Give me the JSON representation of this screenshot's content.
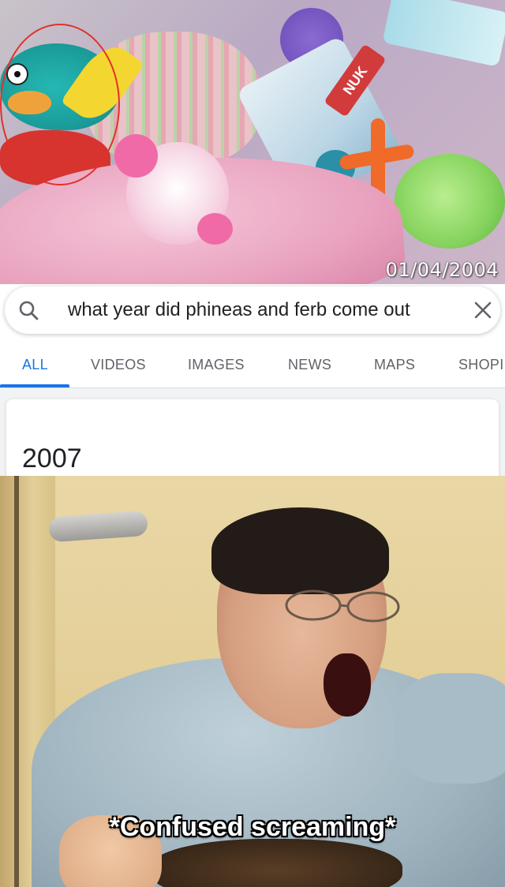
{
  "top_photo": {
    "package_brand": "NUK",
    "date_stamp": "01/04/2004"
  },
  "search": {
    "query": "what year did phineas and ferb come out",
    "search_icon": "search-icon",
    "clear_icon": "close-icon"
  },
  "tabs": [
    {
      "label": "ALL",
      "active": true
    },
    {
      "label": "VIDEOS",
      "active": false
    },
    {
      "label": "IMAGES",
      "active": false
    },
    {
      "label": "NEWS",
      "active": false
    },
    {
      "label": "MAPS",
      "active": false
    },
    {
      "label": "SHOPI",
      "active": false
    }
  ],
  "answer": {
    "value": "2007"
  },
  "meme": {
    "caption": "*Confused screaming*"
  },
  "colors": {
    "accent_blue": "#1a73e8",
    "annotation_red": "#e0322a",
    "tab_inactive": "#5f6368"
  }
}
